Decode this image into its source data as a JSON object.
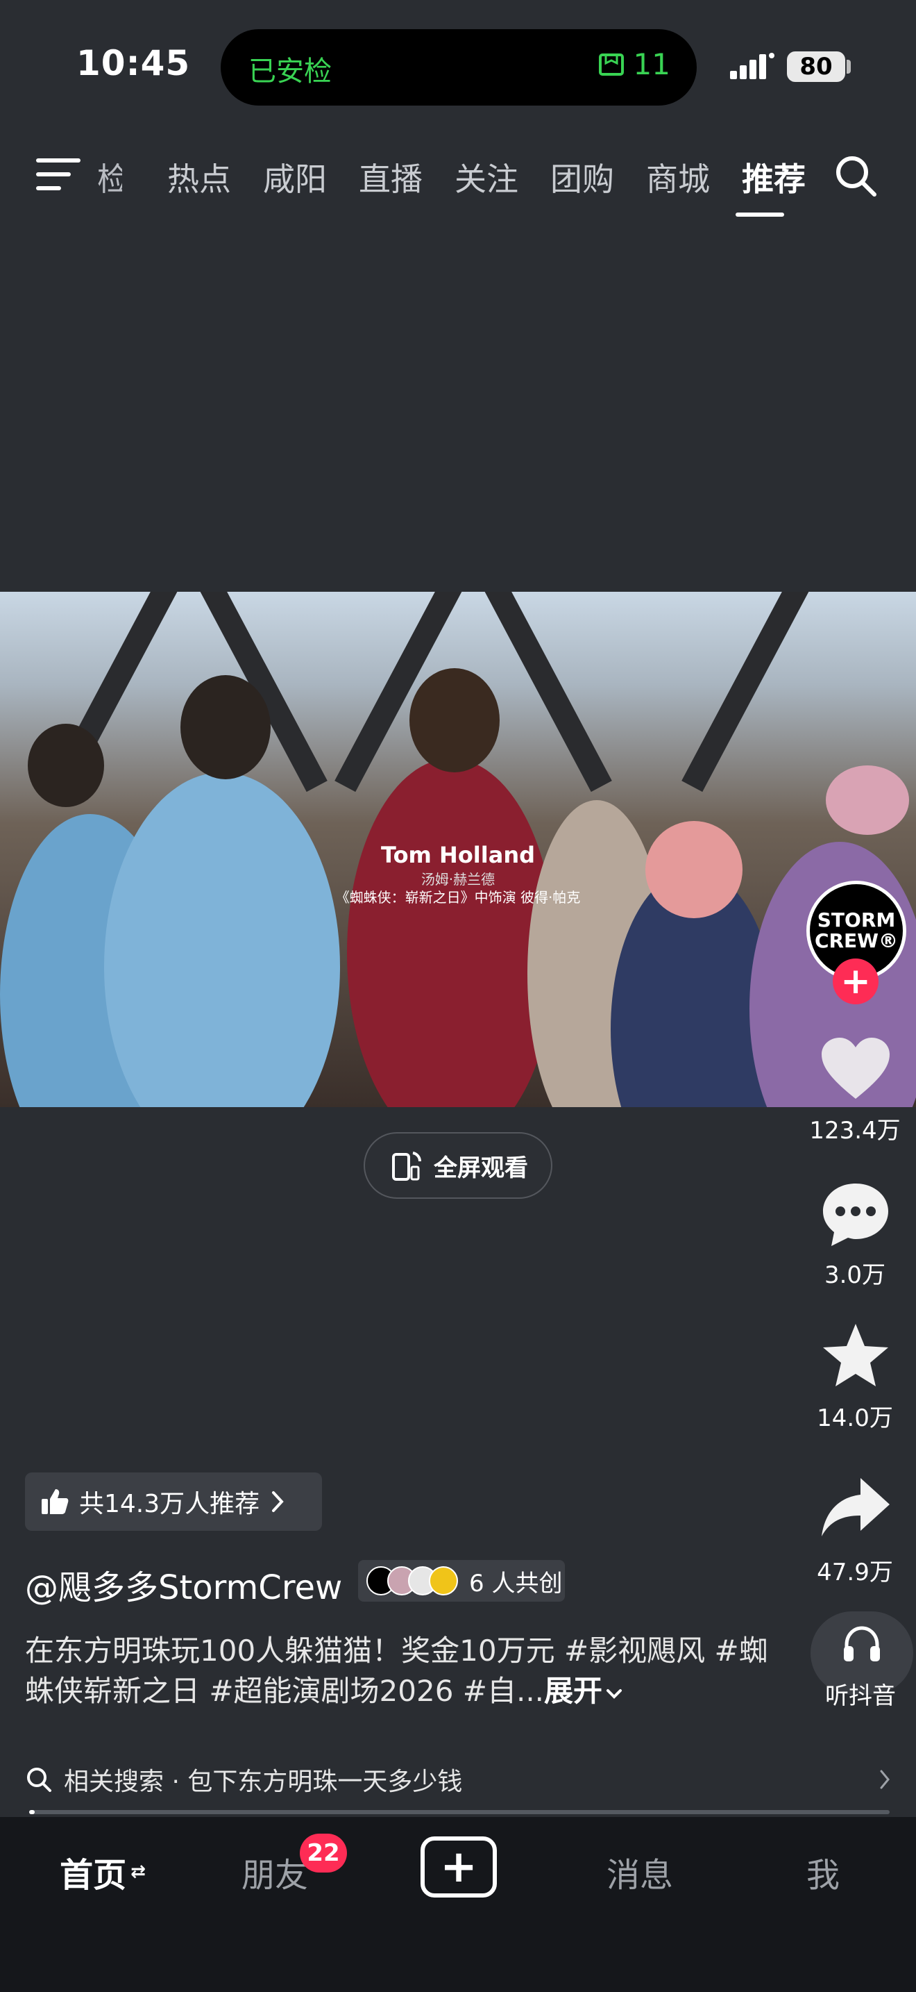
{
  "status_bar": {
    "time": "10:45",
    "island_left": "已安检",
    "island_right_count": "11",
    "battery": "80"
  },
  "nav": {
    "cut_tab": "检",
    "tabs": [
      "热点",
      "咸阳",
      "直播",
      "关注",
      "团购",
      "商城",
      "推荐"
    ],
    "active_tab": "推荐"
  },
  "video": {
    "caption_name": "Tom Holland",
    "caption_sub": "汤姆·赫兰德",
    "caption_role": "《蜘蛛侠：崭新之日》中饰演 彼得·帕克"
  },
  "fullscreen_label": "全屏观看",
  "author_avatar_text": [
    "STORM",
    "CREW®"
  ],
  "actions": {
    "likes": "123.4万",
    "comments": "3.0万",
    "favorites": "14.0万",
    "shares": "47.9万",
    "listen": "听抖音"
  },
  "recommend_chip": "共14.3万人推荐",
  "author": "@飓多多StormCrew",
  "cocreate": "6 人共创",
  "description": "在东方明珠玩100人躲猫猫！奖金10万元 #影视飓风 #蜘蛛侠崭新之日 #超能演剧场2026 #自...",
  "description_more": "展开",
  "related_search": "相关搜索 · 包下东方明珠一天多少钱",
  "tabbar": {
    "home": "首页",
    "friends": "朋友",
    "friends_badge": "22",
    "messages": "消息",
    "me": "我"
  },
  "colors": {
    "background": "#2a2d32",
    "accent_red": "#fe2c55",
    "island_green": "#39d353",
    "tabbar": "#15171b"
  }
}
